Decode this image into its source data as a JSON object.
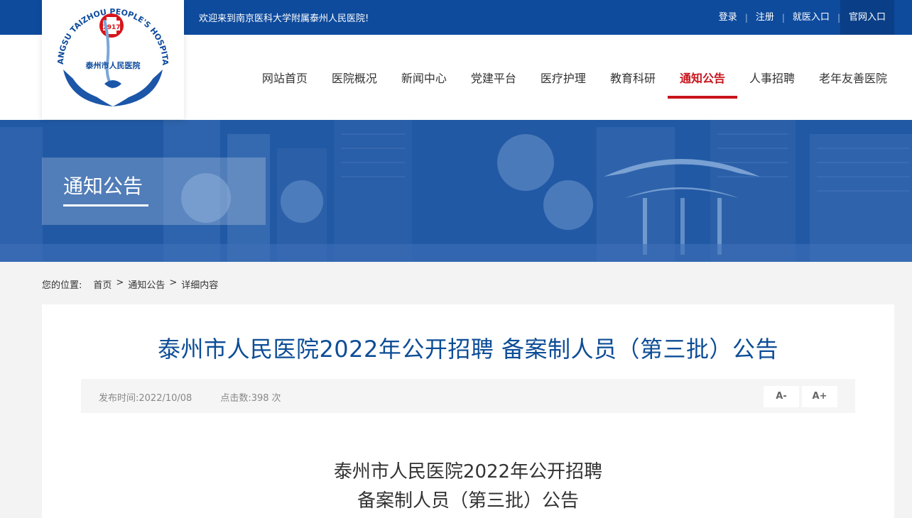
{
  "topbar": {
    "welcome": "欢迎来到南京医科大学附属泰州人民医院!",
    "links": [
      "登录",
      "注册",
      "就医入口",
      "官网入口"
    ]
  },
  "logo": {
    "ring_text": "JIANGSU TAIZHOU PEOPLE'S HOSPITAL",
    "year": "1917",
    "name": "泰州市人民医院"
  },
  "nav": {
    "items": [
      "网站首页",
      "医院概况",
      "新闻中心",
      "党建平台",
      "医疗护理",
      "教育科研",
      "通知公告",
      "人事招聘",
      "老年友善医院"
    ],
    "active": "通知公告"
  },
  "banner": {
    "title": "通知公告"
  },
  "breadcrumb": {
    "label": "您的位置:",
    "items": [
      "首页",
      "通知公告",
      "详细内容"
    ],
    "separator": ">"
  },
  "article": {
    "title": "泰州市人民医院2022年公开招聘 备案制人员（第三批）公告",
    "publish_label": "发布时间:",
    "publish_date": "2022/10/08",
    "clicks_label": "点击数:",
    "clicks": "398",
    "clicks_unit": "次",
    "font_minus": "A-",
    "font_plus": "A+",
    "body_title_line1": "泰州市人民医院2022年公开招聘",
    "body_title_line2": "备案制人员（第三批）公告"
  },
  "colors": {
    "primary_blue": "#0e4b9d",
    "active_red": "#c8141c",
    "title_blue": "#0d4d96"
  }
}
